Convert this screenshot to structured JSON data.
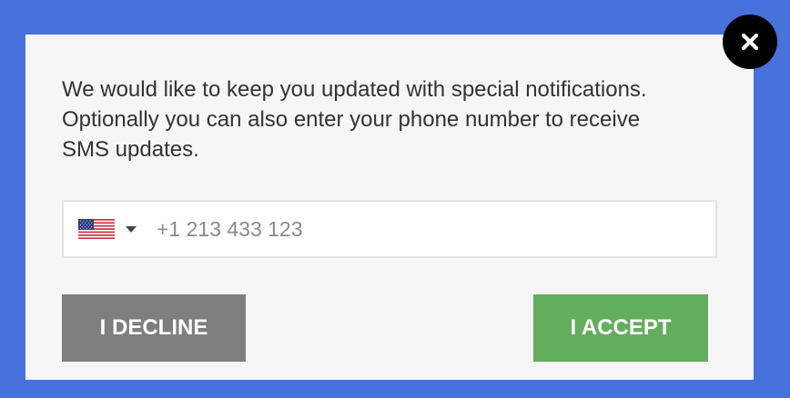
{
  "dialog": {
    "message_lines": [
      "We would like to keep you updated with special notifications.",
      "Optionally you can also enter your phone number to receive",
      "SMS updates."
    ],
    "phone": {
      "country_icon": "us-flag-icon",
      "value": "",
      "placeholder": "+1 213 433 123"
    },
    "decline_label": "I DECLINE",
    "accept_label": "I ACCEPT",
    "close_icon": "close-icon"
  },
  "colors": {
    "backdrop": "#4772dc",
    "modal_background": "#f6f6f6",
    "decline": "#7e7e7e",
    "accept": "#63ae5d",
    "close": "#000000"
  }
}
